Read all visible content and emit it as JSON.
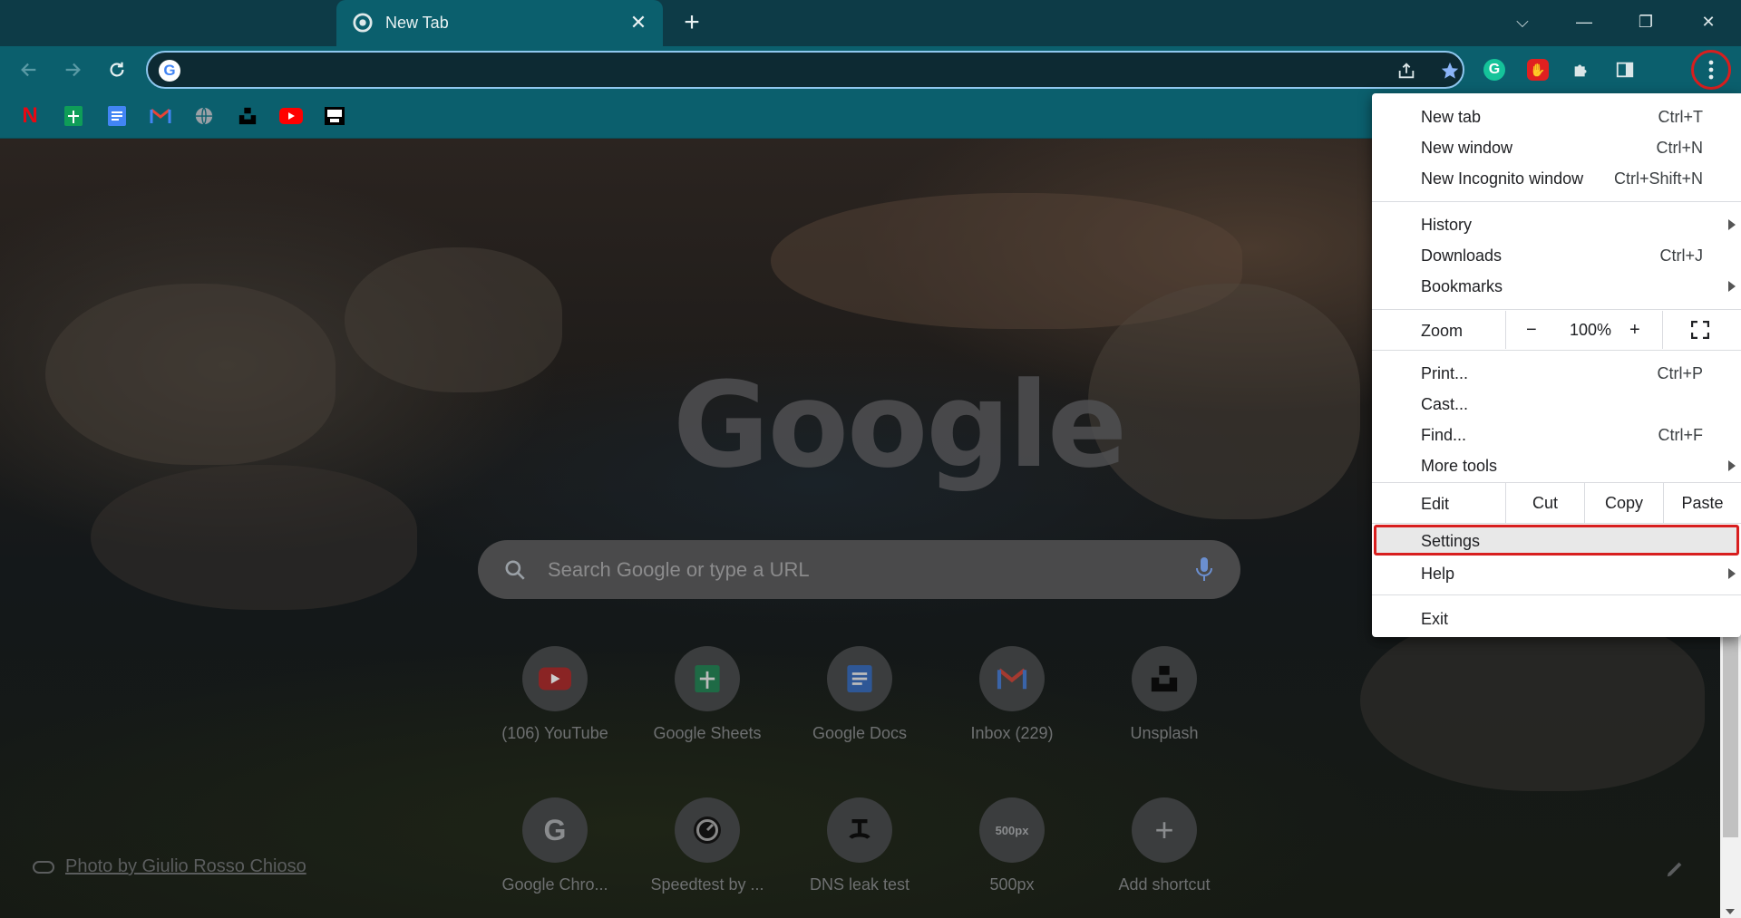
{
  "window": {
    "tab": {
      "title": "New Tab"
    },
    "controls": {
      "dropdown": "⌵",
      "minimize": "—",
      "restore": "❐",
      "close": "✕"
    }
  },
  "toolbar": {
    "omnibox_placeholder": "",
    "extensions": [
      "grammarly-icon",
      "adblock-hand-icon",
      "puzzle-extensions-icon",
      "side-panel-icon"
    ]
  },
  "bookmarks": [
    "netflix",
    "google-sheets",
    "google-docs",
    "gmail",
    "globe",
    "unsplash",
    "youtube",
    "site-icon"
  ],
  "ntp": {
    "logo": "Google",
    "search_placeholder": "Search Google or type a URL",
    "shortcuts": [
      {
        "label": "(106) YouTube",
        "icon": "youtube-icon"
      },
      {
        "label": "Google Sheets",
        "icon": "sheets-icon"
      },
      {
        "label": "Google Docs",
        "icon": "docs-icon"
      },
      {
        "label": "Inbox (229)",
        "icon": "gmail-icon"
      },
      {
        "label": "Unsplash",
        "icon": "unsplash-icon"
      },
      {
        "label": "Google Chro...",
        "icon": "google-icon"
      },
      {
        "label": "Speedtest by ...",
        "icon": "speedtest-icon"
      },
      {
        "label": "DNS leak test",
        "icon": "dns-icon"
      },
      {
        "label": "500px",
        "icon": "500px-icon"
      },
      {
        "label": "Add shortcut",
        "icon": "plus-icon"
      }
    ],
    "photo_credit": "Photo by Giulio Rosso Chioso"
  },
  "menu": {
    "new_tab": {
      "label": "New tab",
      "shortcut": "Ctrl+T"
    },
    "new_window": {
      "label": "New window",
      "shortcut": "Ctrl+N"
    },
    "new_incognito": {
      "label": "New Incognito window",
      "shortcut": "Ctrl+Shift+N"
    },
    "history": {
      "label": "History"
    },
    "downloads": {
      "label": "Downloads",
      "shortcut": "Ctrl+J"
    },
    "bookmarks": {
      "label": "Bookmarks"
    },
    "zoom": {
      "label": "Zoom",
      "minus": "−",
      "value": "100%",
      "plus": "+"
    },
    "print": {
      "label": "Print...",
      "shortcut": "Ctrl+P"
    },
    "cast": {
      "label": "Cast..."
    },
    "find": {
      "label": "Find...",
      "shortcut": "Ctrl+F"
    },
    "more_tools": {
      "label": "More tools"
    },
    "edit": {
      "label": "Edit",
      "cut": "Cut",
      "copy": "Copy",
      "paste": "Paste"
    },
    "settings": {
      "label": "Settings"
    },
    "help": {
      "label": "Help"
    },
    "exit": {
      "label": "Exit"
    }
  },
  "colors": {
    "frame": "#0d3b47",
    "toolbar": "#0b5f6d",
    "highlight_outline": "#d81e1e"
  }
}
